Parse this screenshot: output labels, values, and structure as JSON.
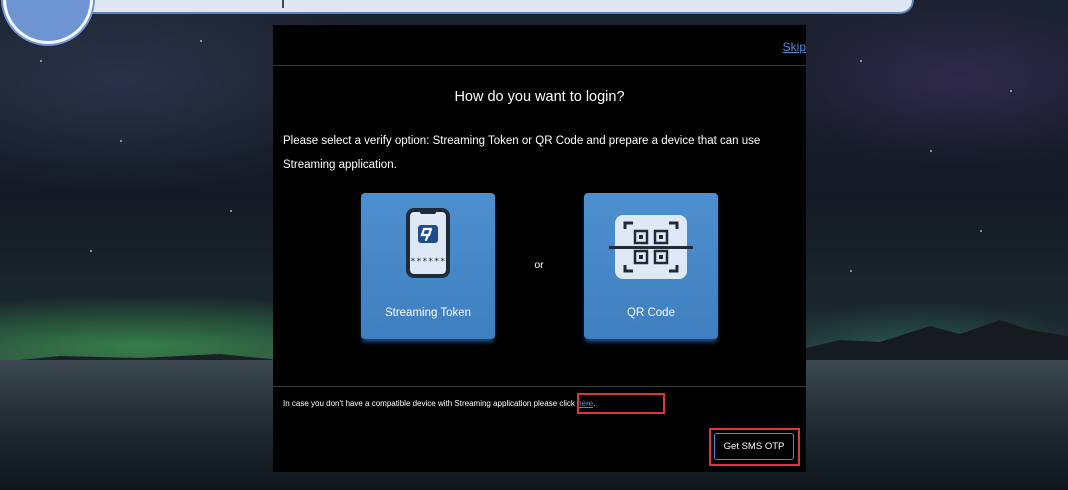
{
  "dialog": {
    "skip_label": "Skip",
    "title": "How do you want to login?",
    "instruction": "Please select a verify option: Streaming Token or QR Code and prepare a device that can use Streaming application.",
    "options": [
      {
        "label": "Streaming Token",
        "icon": "phone-token-icon",
        "masked_code": "******"
      },
      {
        "label": "QR Code",
        "icon": "qr-scan-icon"
      }
    ],
    "or_text": "or",
    "fallback_text": "In case you don't have a compatible device with Streaming application",
    "fallback_prompt": "please click",
    "fallback_link": "here",
    "fallback_end": ".",
    "sms_button_label": "Get SMS OTP"
  },
  "colors": {
    "dialog_bg": "#000000",
    "card_blue": "#4a8ccc",
    "link_blue": "#4f8fd8",
    "highlight_red": "#e0353f"
  }
}
